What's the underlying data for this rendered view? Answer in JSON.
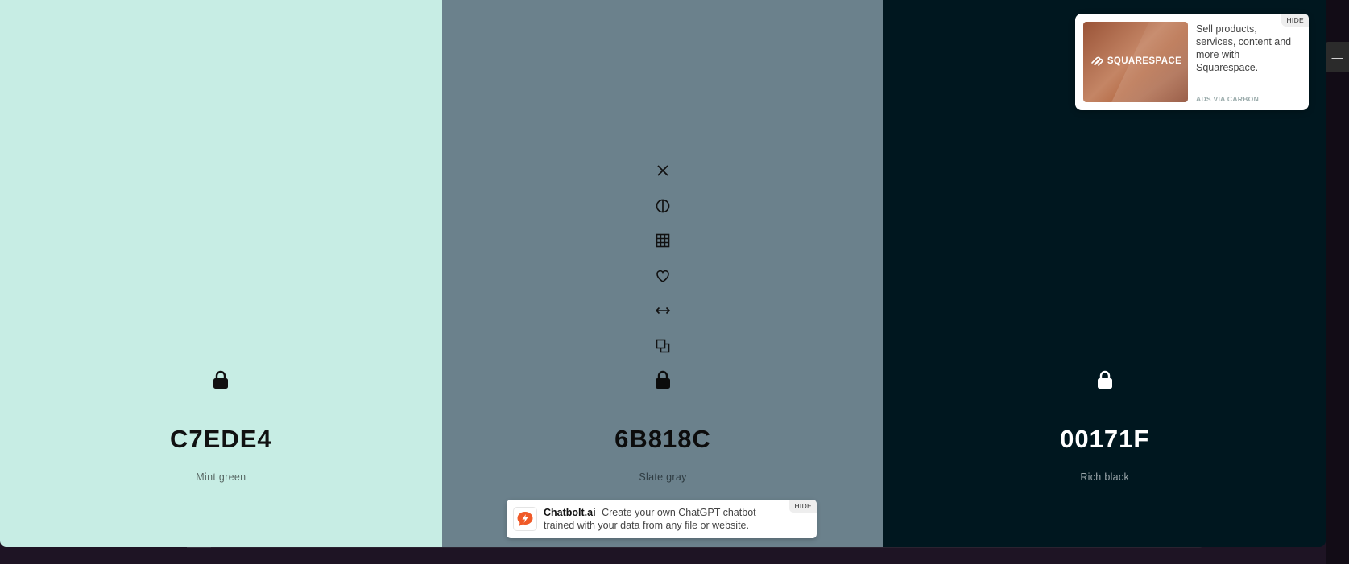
{
  "colors": [
    {
      "hex": "C7EDE4",
      "name": "Mint green",
      "bg": "#C7EDE4",
      "fg": "#111111",
      "sub": "#5a6a66",
      "locked": true,
      "tools_visible": false
    },
    {
      "hex": "6B818C",
      "name": "Slate gray",
      "bg": "#6B818C",
      "fg": "#0c0c0c",
      "sub": "#2e3b41",
      "locked": true,
      "tools_visible": true
    },
    {
      "hex": "00171F",
      "name": "Rich black",
      "bg": "#00171F",
      "fg": "#ffffff",
      "sub": "#9aa6aa",
      "locked": true,
      "tools_visible": false
    }
  ],
  "tools": [
    {
      "id": "remove",
      "icon": "close-icon"
    },
    {
      "id": "shades",
      "icon": "contrast-icon"
    },
    {
      "id": "grid",
      "icon": "grid-icon"
    },
    {
      "id": "favorite",
      "icon": "heart-icon"
    },
    {
      "id": "drag",
      "icon": "drag-arrows-icon"
    },
    {
      "id": "copy",
      "icon": "copy-icon"
    }
  ],
  "carbon_ad": {
    "brand": "SQUARESPACE",
    "text": "Sell products, services, content and more with Squarespace.",
    "via": "ADS VIA CARBON",
    "hide": "HIDE"
  },
  "chatbolt_ad": {
    "brand": "Chatbolt.ai",
    "text": "Create your own ChatGPT chatbot trained with your data from any file or website.",
    "hide": "HIDE",
    "accent": "#F05A28"
  },
  "edge_button": "—"
}
